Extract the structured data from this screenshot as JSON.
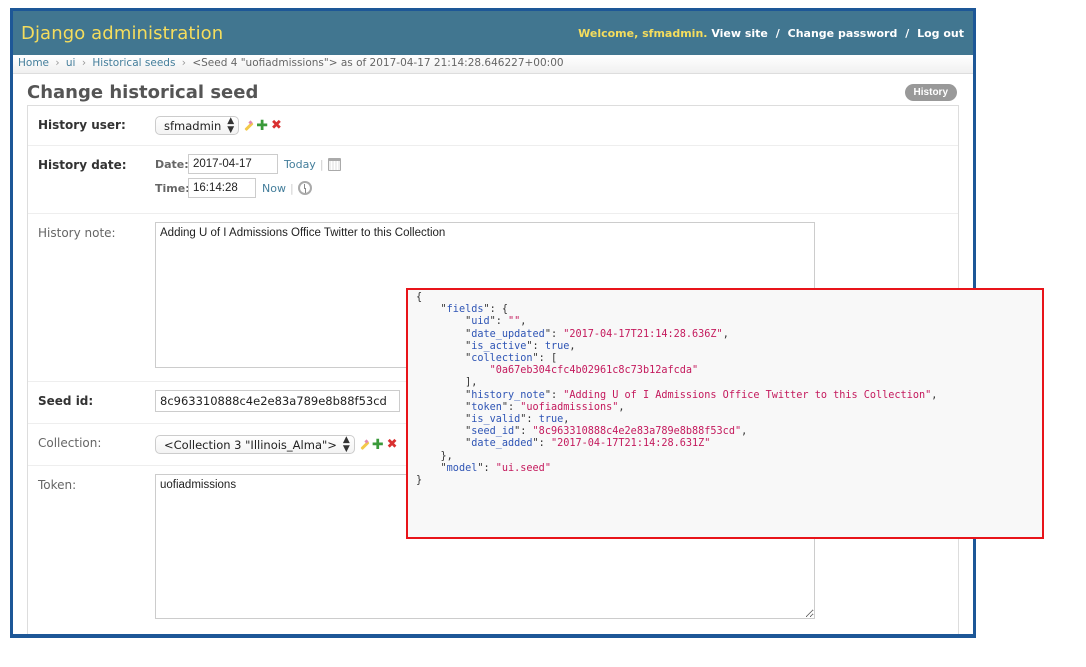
{
  "header": {
    "branding": "Django administration",
    "welcome_prefix": "Welcome,",
    "username": "sfmadmin",
    "welcome_suffix": ".",
    "links": [
      "View site",
      "Change password",
      "Log out"
    ]
  },
  "breadcrumbs": {
    "items": [
      "Home",
      "ui",
      "Historical seeds"
    ],
    "current": "<Seed 4 \"uofiadmissions\"> as of 2017-04-17 21:14:28.646227+00:00",
    "separator": "›"
  },
  "page": {
    "title": "Change historical seed",
    "history_button": "History"
  },
  "form": {
    "history_user": {
      "label": "History user:",
      "value": "sfmadmin"
    },
    "history_date": {
      "label": "History date:",
      "date_label": "Date:",
      "date_value": "2017-04-17",
      "today_link": "Today",
      "time_label": "Time:",
      "time_value": "16:14:28",
      "now_link": "Now"
    },
    "history_note": {
      "label": "History note:",
      "value": "Adding U of I Admissions Office Twitter to this Collection"
    },
    "seed_id": {
      "label": "Seed id:",
      "value": "8c963310888c4e2e83a789e8b88f53cd"
    },
    "collection": {
      "label": "Collection:",
      "value": "<Collection 3 \"Illinois_Alma\">"
    },
    "token": {
      "label": "Token:",
      "value": "uofiadmissions"
    }
  },
  "json_overlay": {
    "fields_key": "fields",
    "entries": [
      {
        "key": "uid",
        "value": "\"\"",
        "type": "string"
      },
      {
        "key": "date_updated",
        "value": "\"2017-04-17T21:14:28.636Z\"",
        "type": "string"
      },
      {
        "key": "is_active",
        "value": "true",
        "type": "bool"
      },
      {
        "key": "collection",
        "value": "\"0a67eb304cfc4b02961c8c73b12afcda\"",
        "type": "array"
      },
      {
        "key": "history_note",
        "value": "\"Adding U of I Admissions Office Twitter to this Collection\"",
        "type": "string"
      },
      {
        "key": "token",
        "value": "\"uofiadmissions\"",
        "type": "string"
      },
      {
        "key": "is_valid",
        "value": "true",
        "type": "bool"
      },
      {
        "key": "seed_id",
        "value": "\"8c963310888c4e2e83a789e8b88f53cd\"",
        "type": "string"
      },
      {
        "key": "date_added",
        "value": "\"2017-04-17T21:14:28.631Z\"",
        "type": "string"
      }
    ],
    "model_key": "model",
    "model_value": "\"ui.seed\""
  },
  "colors": {
    "header_bg": "#417690",
    "branding": "#f5dd5d",
    "link": "#447e9b",
    "frame_border": "#1d5797",
    "overlay_border": "#e8141a",
    "json_key": "#2f55b5",
    "json_string": "#c41a5d"
  }
}
